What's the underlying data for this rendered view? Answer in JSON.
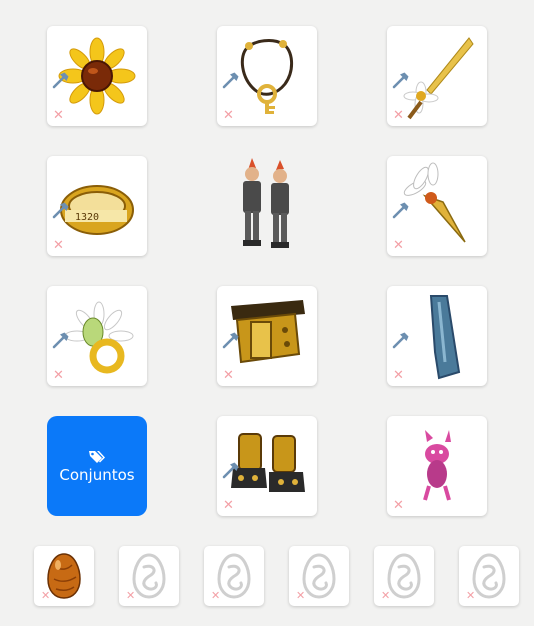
{
  "equipment": {
    "sets_button": {
      "label": "Conjuntos",
      "icon": "tag-icon"
    },
    "slots": [
      {
        "name": "amulet",
        "item": "sunflower-amulet"
      },
      {
        "name": "amulet-2",
        "item": "key-necklace"
      },
      {
        "name": "weapon",
        "item": "daisy-sword"
      },
      {
        "name": "ring",
        "item": "numbered-gold-ring"
      },
      {
        "name": "character",
        "item": "character-pair-preview"
      },
      {
        "name": "hat",
        "item": "feathered-gold-hat"
      },
      {
        "name": "ring-2",
        "item": "daisy-egg-ring"
      },
      {
        "name": "belt",
        "item": "gold-belt"
      },
      {
        "name": "cape",
        "item": "blue-cape"
      },
      {
        "name": "boots",
        "item": "gold-boots"
      },
      {
        "name": "pet",
        "item": "pink-pet"
      }
    ],
    "dofus_slots": [
      {
        "name": "dofus-1",
        "item": "amber-dofus"
      },
      {
        "name": "dofus-2",
        "item": "empty-dofus-placeholder"
      },
      {
        "name": "dofus-3",
        "item": "empty-dofus-placeholder"
      },
      {
        "name": "dofus-4",
        "item": "empty-dofus-placeholder"
      },
      {
        "name": "dofus-5",
        "item": "empty-dofus-placeholder"
      },
      {
        "name": "dofus-6",
        "item": "empty-dofus-placeholder"
      }
    ],
    "colors": {
      "sets_button": "#0b79f9",
      "background": "#f2f2f1",
      "remove_x": "#f3a0a6",
      "hammer": "#6d8fb0"
    }
  }
}
